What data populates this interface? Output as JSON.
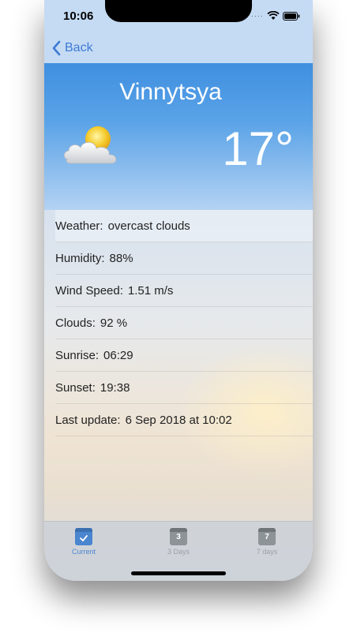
{
  "status": {
    "time": "10:06"
  },
  "nav": {
    "back_label": "Back"
  },
  "hero": {
    "city": "Vinnytsya",
    "temperature": "17°",
    "condition_icon": "partly-cloudy-icon"
  },
  "details": [
    {
      "label": "Weather:",
      "value": "overcast clouds"
    },
    {
      "label": "Humidity:",
      "value": "88%"
    },
    {
      "label": "Wind Speed:",
      "value": "1.51 m/s"
    },
    {
      "label": "Clouds:",
      "value": "92 %"
    },
    {
      "label": "Sunrise:",
      "value": "06:29"
    },
    {
      "label": "Sunset:",
      "value": "19:38"
    },
    {
      "label": "Last update:",
      "value": "6 Sep 2018 at 10:02"
    }
  ],
  "tabs": [
    {
      "label": "Current",
      "icon_num": "",
      "active": true
    },
    {
      "label": "3 Days",
      "icon_num": "3",
      "active": false
    },
    {
      "label": "7 days",
      "icon_num": "7",
      "active": false
    }
  ],
  "colors": {
    "accent": "#4a85cf",
    "hero_top": "#3f8fe0",
    "navbar": "#c5dbf4"
  }
}
